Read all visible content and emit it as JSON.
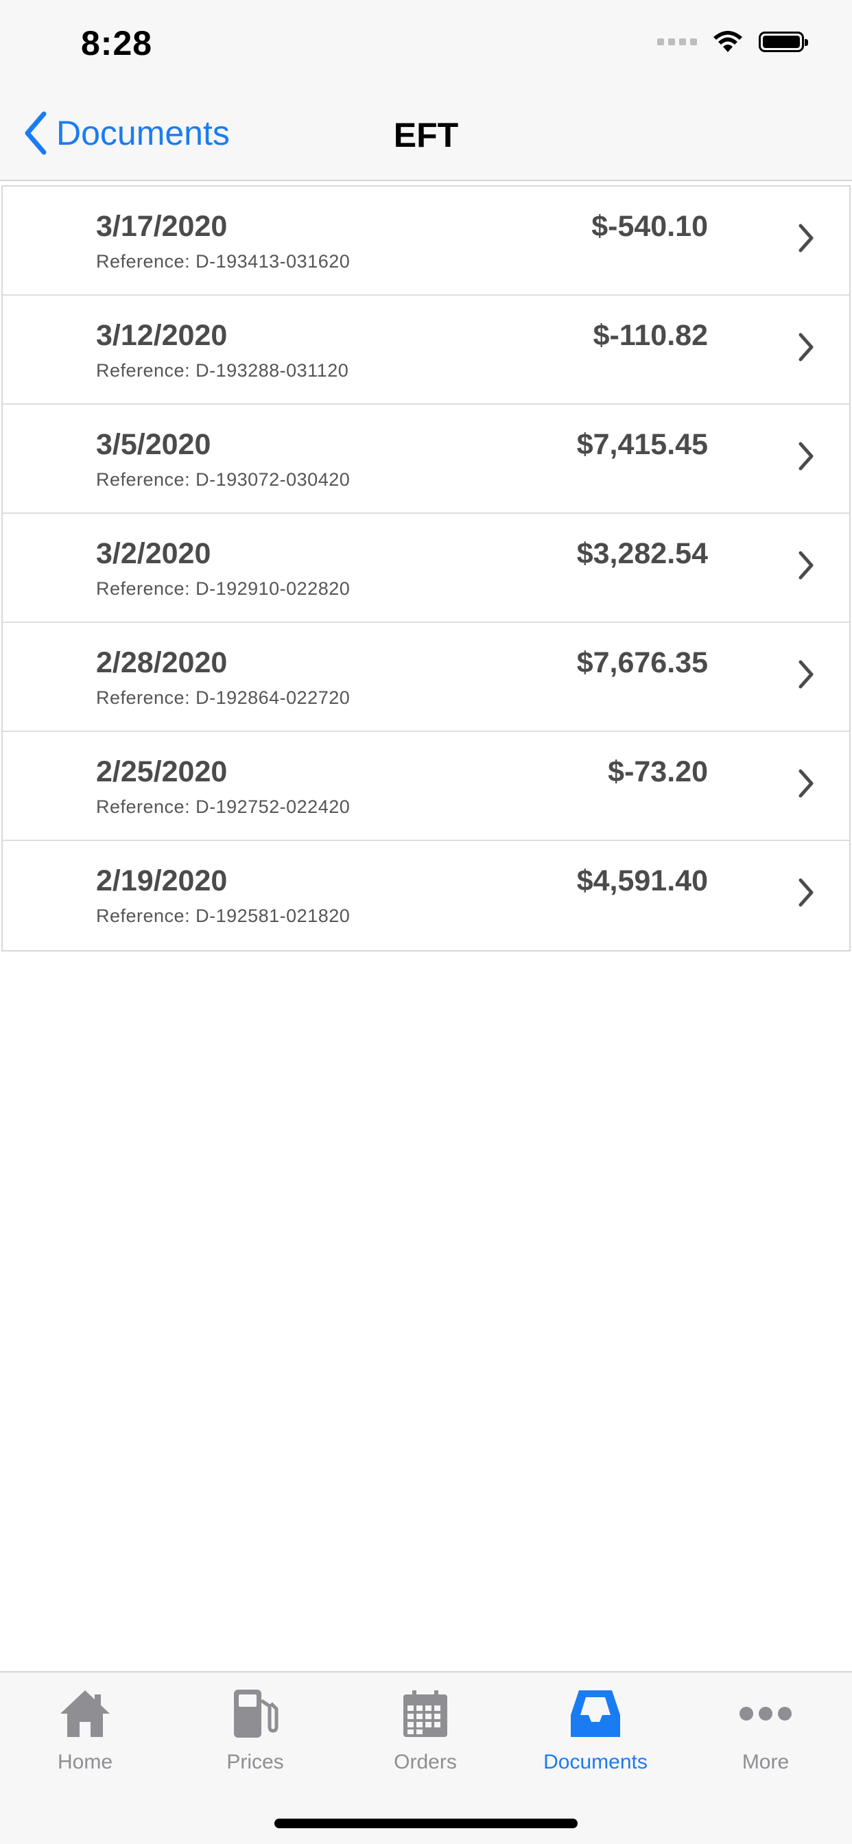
{
  "status": {
    "time": "8:28"
  },
  "nav": {
    "back_label": "Documents",
    "title": "EFT"
  },
  "rows": [
    {
      "date": "3/17/2020",
      "reference": "Reference: D-193413-031620",
      "amount": "$-540.10"
    },
    {
      "date": "3/12/2020",
      "reference": "Reference: D-193288-031120",
      "amount": "$-110.82"
    },
    {
      "date": "3/5/2020",
      "reference": "Reference: D-193072-030420",
      "amount": "$7,415.45"
    },
    {
      "date": "3/2/2020",
      "reference": "Reference: D-192910-022820",
      "amount": "$3,282.54"
    },
    {
      "date": "2/28/2020",
      "reference": "Reference: D-192864-022720",
      "amount": "$7,676.35"
    },
    {
      "date": "2/25/2020",
      "reference": "Reference: D-192752-022420",
      "amount": "$-73.20"
    },
    {
      "date": "2/19/2020",
      "reference": "Reference: D-192581-021820",
      "amount": "$4,591.40"
    }
  ],
  "tabs": [
    {
      "label": "Home",
      "icon": "home-icon"
    },
    {
      "label": "Prices",
      "icon": "fuel-pump-icon"
    },
    {
      "label": "Orders",
      "icon": "calendar-icon"
    },
    {
      "label": "Documents",
      "icon": "inbox-tray-icon",
      "active": true
    },
    {
      "label": "More",
      "icon": "more-dots-icon"
    }
  ],
  "colors": {
    "accent": "#1a7cf2",
    "inactive": "#8e8e93",
    "text": "#4b4b4b"
  }
}
